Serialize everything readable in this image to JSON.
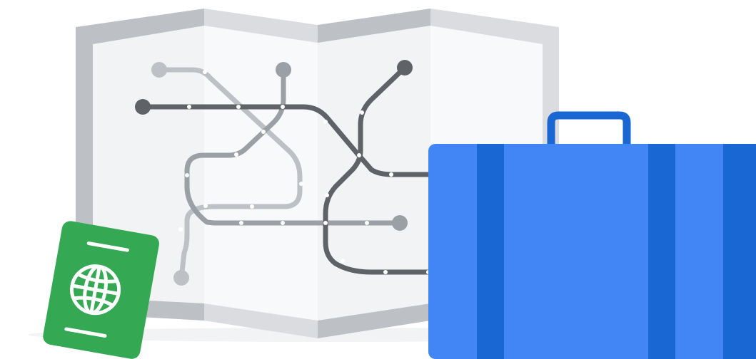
{
  "scene": {
    "description_items": [
      "folded-transit-map",
      "passport",
      "suitcase"
    ]
  },
  "colors": {
    "background": "#ffffff",
    "map_frame_light": "#dadce0",
    "map_frame_dark": "#bdc1c6",
    "map_panel": "#f1f3f4",
    "map_panel_alt": "#e8eaed",
    "route_light": "#bdc1c6",
    "route_mid": "#9aa0a6",
    "route_dark": "#5f6368",
    "station_stop": "#ffffff",
    "passport_green": "#34a853",
    "passport_line": "#ffffff",
    "suitcase_body": "#4285f4",
    "suitcase_strap": "#1967d2",
    "shadow": "#e8eaed"
  },
  "icons": {
    "map": "transit-map-icon",
    "passport": "passport-icon",
    "globe": "globe-icon",
    "suitcase": "suitcase-icon",
    "handle": "suitcase-handle-icon"
  }
}
